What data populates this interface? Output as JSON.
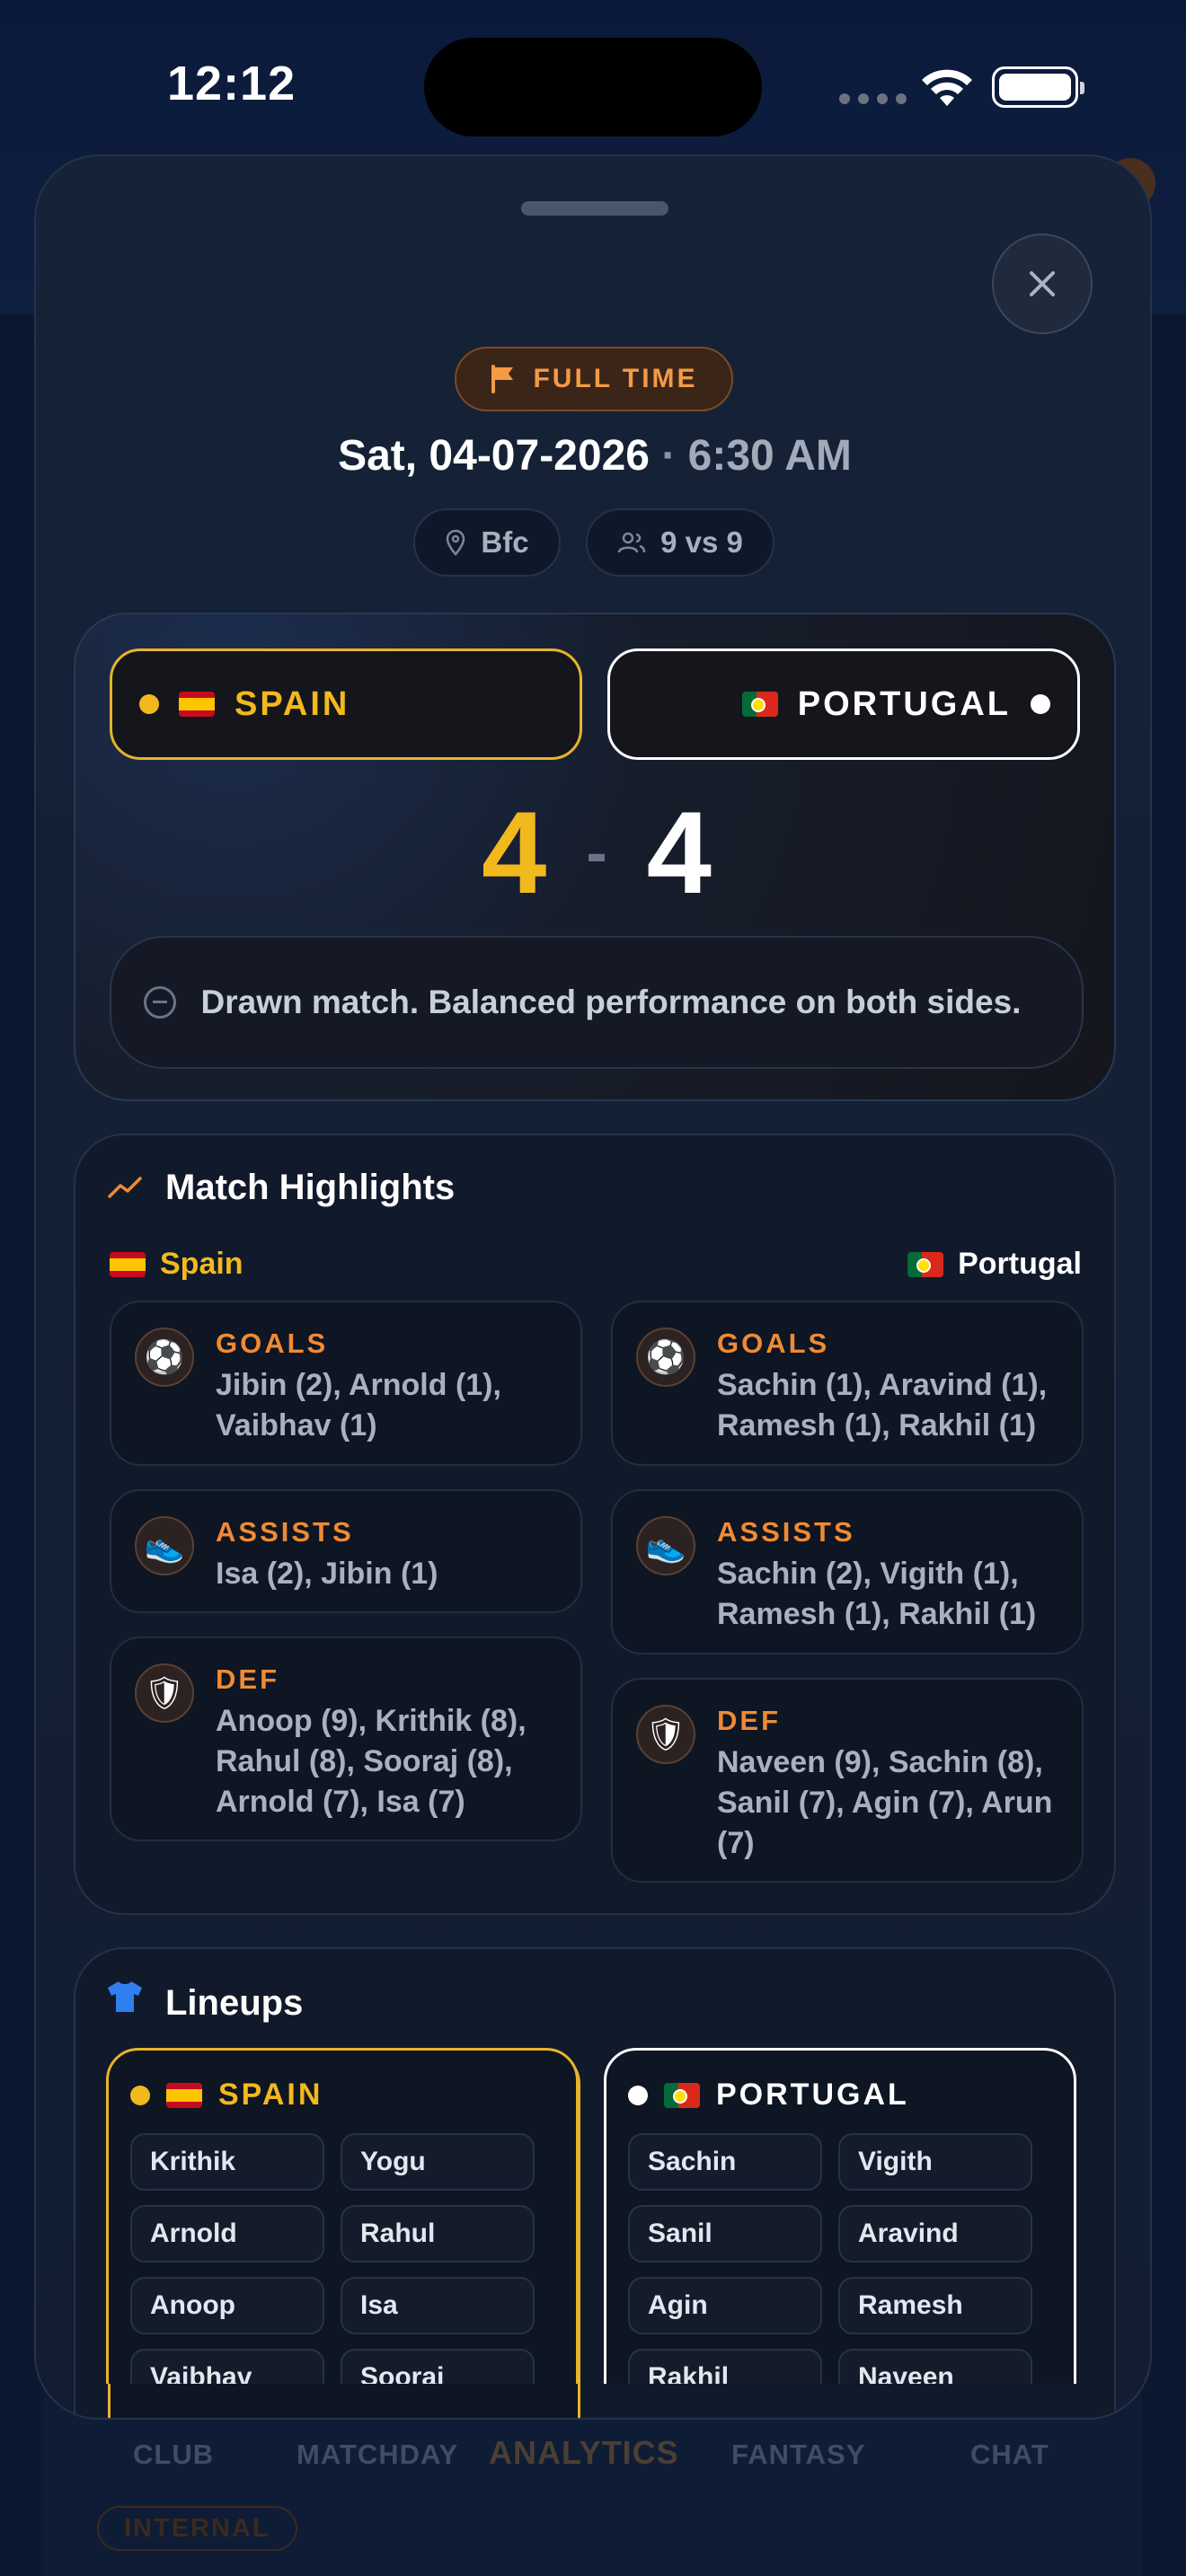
{
  "status_bar": {
    "time": "12:12"
  },
  "background_tabs": {
    "items": [
      "CLUB",
      "MATCHDAY",
      "ANALYTICS",
      "FANTASY",
      "CHAT"
    ],
    "active": "ANALYTICS",
    "internal_badge": "INTERNAL"
  },
  "match": {
    "status": "FULL TIME",
    "date": "Sat, 04-07-2026",
    "separator": "·",
    "time": "6:30 AM",
    "venue": "Bfc",
    "format": "9 vs 9",
    "home": {
      "name": "SPAIN",
      "score": "4",
      "color": "#f2b91e"
    },
    "away": {
      "name": "PORTUGAL",
      "score": "4",
      "color": "#ffffff"
    },
    "score_separator": "-",
    "summary": "Drawn match. Balanced performance on both sides."
  },
  "highlights": {
    "title": "Match Highlights",
    "home_team": "Spain",
    "away_team": "Portugal",
    "home": {
      "goals_label": "GOALS",
      "goals": "Jibin (2), Arnold (1), Vaibhav (1)",
      "assists_label": "ASSISTS",
      "assists": "Isa (2), Jibin (1)",
      "def_label": "DEF",
      "def": "Anoop (9), Krithik (8), Rahul (8), Sooraj (8), Arnold (7), Isa (7)"
    },
    "away": {
      "goals_label": "GOALS",
      "goals": "Sachin (1), Aravind (1), Ramesh (1), Rakhil (1)",
      "assists_label": "ASSISTS",
      "assists": "Sachin (2), Vigith (1), Ramesh (1), Rakhil (1)",
      "def_label": "DEF",
      "def": "Naveen (9), Sachin (8), Sanil (7), Agin (7), Arun (7)"
    }
  },
  "lineups": {
    "title": "Lineups",
    "home": {
      "name": "SPAIN",
      "players": [
        "Krithik",
        "Yogu",
        "Arnold",
        "Rahul",
        "Anoop",
        "Isa",
        "Vaibhav",
        "Sooraj"
      ]
    },
    "away": {
      "name": "PORTUGAL",
      "players": [
        "Sachin",
        "Vigith",
        "Sanil",
        "Aravind",
        "Agin",
        "Ramesh",
        "Rakhil",
        "Naveen"
      ]
    }
  },
  "colors": {
    "accent_orange": "#f08a34",
    "home_yellow": "#f2b91e",
    "sheet_bg": "#152237"
  }
}
